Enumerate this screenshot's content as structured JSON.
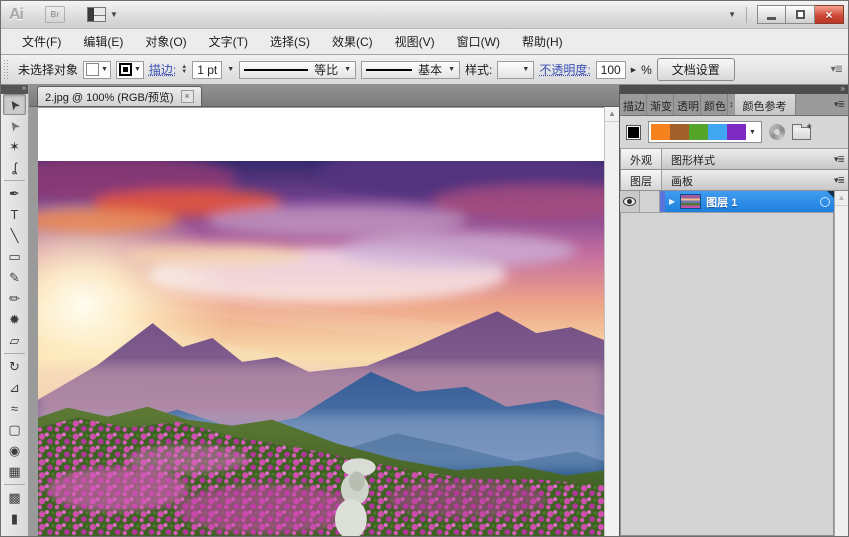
{
  "titlebar": {
    "logo": "Ai",
    "bridge_label": "Br",
    "workspace_caret": "▼",
    "menu_caret": "▼",
    "minimize": "",
    "restore": "",
    "close_glyph": "×"
  },
  "menu_bar": {
    "items": [
      "文件(F)",
      "编辑(E)",
      "对象(O)",
      "文字(T)",
      "选择(S)",
      "效果(C)",
      "视图(V)",
      "窗口(W)",
      "帮助(H)"
    ]
  },
  "control_bar": {
    "status": "未选择对象",
    "stroke_label": "描边:",
    "stroke_weight": "1 pt",
    "profile_label": "等比",
    "brush_label": "基本",
    "style_label": "样式:",
    "opacity_label": "不透明度:",
    "opacity_value": "100",
    "percent_sign": "%",
    "doc_setup_label": "文档设置",
    "panel_icon": "▾≣"
  },
  "document": {
    "tab_title": "2.jpg @ 100% (RGB/预览)",
    "close_glyph": "×",
    "scroll_up_glyph": "▲"
  },
  "tools": [
    {
      "name": "selection-tool",
      "glyph": "➤"
    },
    {
      "name": "direct-selection-tool",
      "glyph": "➤"
    },
    {
      "name": "magic-wand-tool",
      "glyph": "✶"
    },
    {
      "name": "lasso-tool",
      "glyph": "ʆ"
    },
    {
      "name": "pen-tool",
      "glyph": "✒"
    },
    {
      "name": "type-tool",
      "glyph": "T"
    },
    {
      "name": "line-segment-tool",
      "glyph": "╲"
    },
    {
      "name": "rectangle-tool",
      "glyph": "▭"
    },
    {
      "name": "paintbrush-tool",
      "glyph": "✎"
    },
    {
      "name": "pencil-tool",
      "glyph": "✏"
    },
    {
      "name": "blob-brush-tool",
      "glyph": "✹"
    },
    {
      "name": "eraser-tool",
      "glyph": "▱"
    },
    {
      "name": "rotate-tool",
      "glyph": "↻"
    },
    {
      "name": "scale-tool",
      "glyph": "⊿"
    },
    {
      "name": "width-tool",
      "glyph": "≈"
    },
    {
      "name": "free-transform-tool",
      "glyph": "▢"
    },
    {
      "name": "shape-builder-tool",
      "glyph": "◉"
    },
    {
      "name": "perspective-grid-tool",
      "glyph": "▦"
    },
    {
      "name": "mesh-tool",
      "glyph": "▩"
    },
    {
      "name": "gradient-tool",
      "glyph": "▮"
    }
  ],
  "dock": {
    "collapse_glyph": "»",
    "panel_menu_glyph": "▾≣",
    "color_guide": {
      "tabs": [
        "描边",
        "渐变",
        "透明",
        "颜色"
      ],
      "overflow_glyph": "↕",
      "active_tab": "颜色参考",
      "base_color": "#000000",
      "harmony_colors": [
        "#F5821F",
        "#A2602A",
        "#55A528",
        "#3FA6EF",
        "#7E2BC4"
      ],
      "dropdown_caret": "▼"
    },
    "appearance": {
      "tabs": [
        "外观",
        "图形样式"
      ],
      "active": "外观"
    },
    "layers": {
      "tabs": [
        "图层",
        "画板"
      ],
      "active": "图层",
      "rows": [
        {
          "name": "图层 1",
          "disclosure": "▶"
        }
      ],
      "scroll_up_glyph": "▲"
    }
  }
}
